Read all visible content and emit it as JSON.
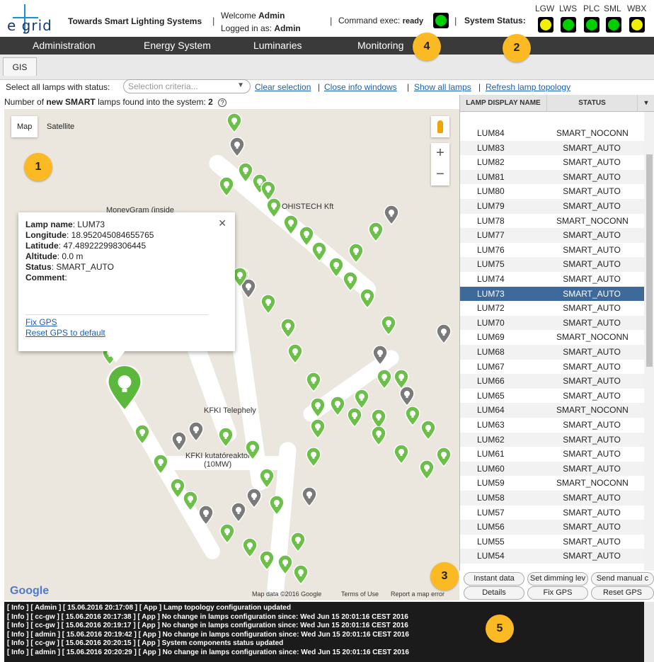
{
  "header": {
    "logo_text": "e grid",
    "title": "Towards Smart Lighting Systems",
    "welcome_prefix": "Welcome",
    "welcome_user": "Admin",
    "logged_prefix": "Logged in as:",
    "logged_user": "Admin",
    "command_label": "Command exec:",
    "command_state": "ready",
    "system_status_label": "System Status:",
    "status_leds": [
      {
        "label": "LGW",
        "color": "#f0f000"
      },
      {
        "label": "LWS",
        "color": "#00d000"
      },
      {
        "label": "PLC",
        "color": "#00d000"
      },
      {
        "label": "SML",
        "color": "#00d000"
      },
      {
        "label": "WBX",
        "color": "#f0f000"
      }
    ],
    "command_led_color": "#00d000"
  },
  "nav": {
    "items": [
      "Administration",
      "Energy System",
      "Luminaries",
      "Monitoring"
    ]
  },
  "subnav": {
    "tab": "GIS"
  },
  "filter": {
    "label": "Select all lamps with status:",
    "placeholder": "Selection criteria...",
    "links": [
      "Clear selection",
      "Close info windows",
      "Show all lamps",
      "Refresh lamp topology"
    ]
  },
  "count_line": {
    "prefix": "Number of",
    "bold": "new SMART",
    "suffix": "lamps found into the system:",
    "value": "2"
  },
  "map": {
    "tabs": [
      "Map",
      "Satellite"
    ],
    "labels": {
      "moneygram": "MoneyGram (inside",
      "ohistech": "OHISTECH Kft",
      "kfki_tel": "KFKI Telephely",
      "kfki_reactor": "KFKI kutatóreaktor",
      "reactor_power": "(10MW)"
    },
    "footer": {
      "google": "Google",
      "data": "Map data ©2016 Google",
      "terms": "Terms of Use",
      "report": "Report a map error"
    },
    "zoom_in": "+",
    "zoom_out": "−"
  },
  "infowindow": {
    "name_label": "Lamp name",
    "name": "LUM73",
    "lon_label": "Longitude",
    "lon": "18.952045084655765",
    "lat_label": "Latitude",
    "lat": "47.489222998306445",
    "alt_label": "Altitude",
    "alt": "0.0 m",
    "status_label": "Status",
    "status": "SMART_AUTO",
    "comment_label": "Comment",
    "link_fix": "Fix GPS",
    "link_reset": "Reset GPS to default",
    "close": "✕"
  },
  "badges": [
    "1",
    "2",
    "3",
    "4",
    "5"
  ],
  "table": {
    "col1": "LAMP DISPLAY NAME",
    "col2": "STATUS",
    "selected": "LUM73",
    "rows": [
      {
        "name": "LUM84",
        "status": "SMART_NOCONN"
      },
      {
        "name": "LUM83",
        "status": "SMART_AUTO"
      },
      {
        "name": "LUM82",
        "status": "SMART_AUTO"
      },
      {
        "name": "LUM81",
        "status": "SMART_AUTO"
      },
      {
        "name": "LUM80",
        "status": "SMART_AUTO"
      },
      {
        "name": "LUM79",
        "status": "SMART_AUTO"
      },
      {
        "name": "LUM78",
        "status": "SMART_NOCONN"
      },
      {
        "name": "LUM77",
        "status": "SMART_AUTO"
      },
      {
        "name": "LUM76",
        "status": "SMART_AUTO"
      },
      {
        "name": "LUM75",
        "status": "SMART_AUTO"
      },
      {
        "name": "LUM74",
        "status": "SMART_AUTO"
      },
      {
        "name": "LUM73",
        "status": "SMART_AUTO"
      },
      {
        "name": "LUM72",
        "status": "SMART_AUTO"
      },
      {
        "name": "LUM70",
        "status": "SMART_AUTO"
      },
      {
        "name": "LUM69",
        "status": "SMART_NOCONN"
      },
      {
        "name": "LUM68",
        "status": "SMART_AUTO"
      },
      {
        "name": "LUM67",
        "status": "SMART_AUTO"
      },
      {
        "name": "LUM66",
        "status": "SMART_AUTO"
      },
      {
        "name": "LUM65",
        "status": "SMART_AUTO"
      },
      {
        "name": "LUM64",
        "status": "SMART_NOCONN"
      },
      {
        "name": "LUM63",
        "status": "SMART_AUTO"
      },
      {
        "name": "LUM62",
        "status": "SMART_AUTO"
      },
      {
        "name": "LUM61",
        "status": "SMART_AUTO"
      },
      {
        "name": "LUM60",
        "status": "SMART_AUTO"
      },
      {
        "name": "LUM59",
        "status": "SMART_NOCONN"
      },
      {
        "name": "LUM58",
        "status": "SMART_AUTO"
      },
      {
        "name": "LUM57",
        "status": "SMART_AUTO"
      },
      {
        "name": "LUM56",
        "status": "SMART_AUTO"
      },
      {
        "name": "LUM55",
        "status": "SMART_AUTO"
      },
      {
        "name": "LUM54",
        "status": "SMART_AUTO"
      }
    ]
  },
  "buttons": {
    "instant_data": "Instant data",
    "set_dimming": "Set dimming lev",
    "send_manual": "Send manual c",
    "details": "Details",
    "fix_gps": "Fix GPS",
    "reset_gps": "Reset GPS"
  },
  "log": [
    "[ Info ] [ Admin ] [ 15.06.2016 20:17:08 ] [ App ] Lamp topology configuration updated",
    "[ Info ] [ cc-gw ] [ 15.06.2016 20:17:38 ] [ App ] No change in lamps configuration since: Wed Jun 15 20:01:16 CEST 2016",
    "[ Info ] [ cc-gw ] [ 15.06.2016 20:19:17 ] [ App ] No change in lamps configuration since: Wed Jun 15 20:01:16 CEST 2016",
    "[ Info ] [ admin ] [ 15.06.2016 20:19:42 ] [ App ] No change in lamps configuration since: Wed Jun 15 20:01:16 CEST 2016",
    "[ Info ] [ cc-gw ] [ 15.06.2016 20:20:15 ] [ App ] System components status updated",
    "[ Info ] [ admin ] [ 15.06.2016 20:20:29 ] [ App ] No change in lamps configuration since: Wed Jun 15 20:01:16 CEST 2016"
  ]
}
